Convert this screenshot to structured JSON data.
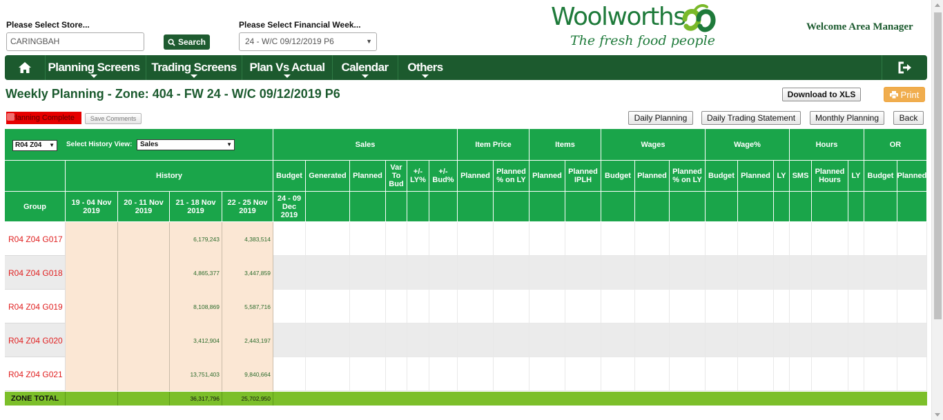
{
  "header": {
    "store_label": "Please Select Store...",
    "store_value": "CARINGBAH",
    "search_label": "Search",
    "week_label": "Please Select Financial Week...",
    "week_value": "24 - W/C 09/12/2019 P6",
    "logo_word": "Woolworths",
    "logo_tagline": "The fresh food people",
    "welcome": "Welcome Area Manager"
  },
  "nav": {
    "items": [
      "Planning Screens",
      "Trading Screens",
      "Plan Vs Actual",
      "Calendar",
      "Others"
    ],
    "home_icon": "home-icon",
    "logout_icon": "logout-icon"
  },
  "page": {
    "title": "Weekly Planning - Zone: 404 - FW 24 - W/C 09/12/2019 P6",
    "download_label": "Download to XLS",
    "print_label": "Print",
    "planning_complete": "Planning Complete",
    "save_comments": "Save Comments",
    "daily_planning": "Daily Planning",
    "daily_trading": "Daily Trading Statement",
    "monthly_planning": "Monthly Planning",
    "back": "Back"
  },
  "grid": {
    "zone_select": "R04 Z04",
    "history_view_label": "Select History View:",
    "history_view_value": "Sales",
    "group_header": {
      "sales": "Sales",
      "item_price": "Item Price",
      "items": "Items",
      "wages": "Wages",
      "wage_pct": "Wage%",
      "hours": "Hours",
      "or": "OR",
      "history": "History",
      "group": "Group"
    },
    "sub_headers": [
      "Budget",
      "Generated",
      "Planned",
      "Var To Bud",
      "+/- LY%",
      "+/- Bud%",
      "Planned",
      "Planned % on LY",
      "Planned",
      "Planned IPLH",
      "Budget",
      "Planned",
      "Planned % on LY",
      "Budget",
      "Planned",
      "LY",
      "SMS",
      "Planned Hours",
      "LY",
      "Budget",
      "Planned"
    ],
    "history_weeks": [
      "19 - 04 Nov 2019",
      "20 - 11 Nov 2019",
      "21 - 18 Nov 2019",
      "22 - 25 Nov 2019"
    ],
    "current_week": "24 - 09 Dec 2019",
    "rows": [
      {
        "group": "R04 Z04 G017",
        "h1": "",
        "h2": "",
        "h3": "6,179,243",
        "h4": "4,383,514"
      },
      {
        "group": "R04 Z04 G018",
        "h1": "",
        "h2": "",
        "h3": "4,865,377",
        "h4": "3,447,859"
      },
      {
        "group": "R04 Z04 G019",
        "h1": "",
        "h2": "",
        "h3": "8,108,869",
        "h4": "5,587,716"
      },
      {
        "group": "R04 Z04 G020",
        "h1": "",
        "h2": "",
        "h3": "3,412,904",
        "h4": "2,443,197"
      },
      {
        "group": "R04 Z04 G021",
        "h1": "",
        "h2": "",
        "h3": "13,751,403",
        "h4": "9,840,664"
      }
    ],
    "total": {
      "label": "ZONE TOTAL",
      "h3": "36,317,796",
      "h4": "25,702,950"
    }
  },
  "colors": {
    "brand_green": "#1c5a2e",
    "header_green": "#1aa54a",
    "total_green": "#7cbf2a",
    "history_bg": "#fbe7d4",
    "alt_row": "#ebebeb",
    "alert_red": "#e60000",
    "print_orange": "#f0ad4e"
  }
}
